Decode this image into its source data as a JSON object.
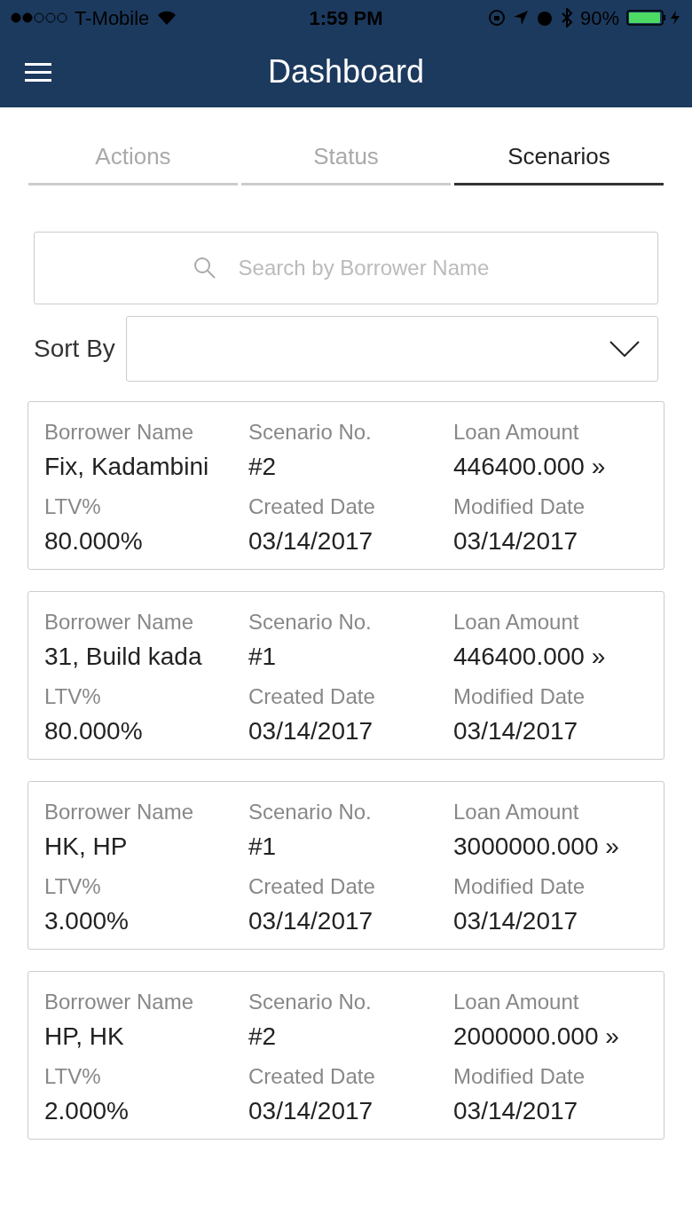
{
  "status_bar": {
    "carrier": "T-Mobile",
    "time": "1:59 PM",
    "battery": "90%"
  },
  "nav": {
    "title": "Dashboard"
  },
  "tabs": [
    {
      "label": "Actions",
      "selected": false
    },
    {
      "label": "Status",
      "selected": false
    },
    {
      "label": "Scenarios",
      "selected": true
    }
  ],
  "search": {
    "placeholder": "Search by Borrower Name"
  },
  "sort": {
    "label": "Sort By"
  },
  "cards": [
    {
      "fields": [
        {
          "label": "Borrower Name",
          "value": "Fix, Kadambini"
        },
        {
          "label": "Scenario No.",
          "value": "#2"
        },
        {
          "label": "Loan Amount",
          "value": "446400.000 »"
        },
        {
          "label": "LTV%",
          "value": "80.000%"
        },
        {
          "label": "Created Date",
          "value": "03/14/2017"
        },
        {
          "label": "Modified Date",
          "value": "03/14/2017"
        }
      ]
    },
    {
      "fields": [
        {
          "label": "Borrower Name",
          "value": "31, Build kada"
        },
        {
          "label": "Scenario No.",
          "value": "#1"
        },
        {
          "label": "Loan Amount",
          "value": "446400.000 »"
        },
        {
          "label": "LTV%",
          "value": "80.000%"
        },
        {
          "label": "Created Date",
          "value": "03/14/2017"
        },
        {
          "label": "Modified Date",
          "value": "03/14/2017"
        }
      ]
    },
    {
      "fields": [
        {
          "label": "Borrower Name",
          "value": "HK, HP"
        },
        {
          "label": "Scenario No.",
          "value": "#1"
        },
        {
          "label": "Loan Amount",
          "value": "3000000.000 »"
        },
        {
          "label": "LTV%",
          "value": "3.000%"
        },
        {
          "label": "Created Date",
          "value": "03/14/2017"
        },
        {
          "label": "Modified Date",
          "value": "03/14/2017"
        }
      ]
    },
    {
      "fields": [
        {
          "label": "Borrower Name",
          "value": "HP, HK"
        },
        {
          "label": "Scenario No.",
          "value": "#2"
        },
        {
          "label": "Loan Amount",
          "value": "2000000.000 »"
        },
        {
          "label": "LTV%",
          "value": "2.000%"
        },
        {
          "label": "Created Date",
          "value": "03/14/2017"
        },
        {
          "label": "Modified Date",
          "value": "03/14/2017"
        }
      ]
    }
  ]
}
